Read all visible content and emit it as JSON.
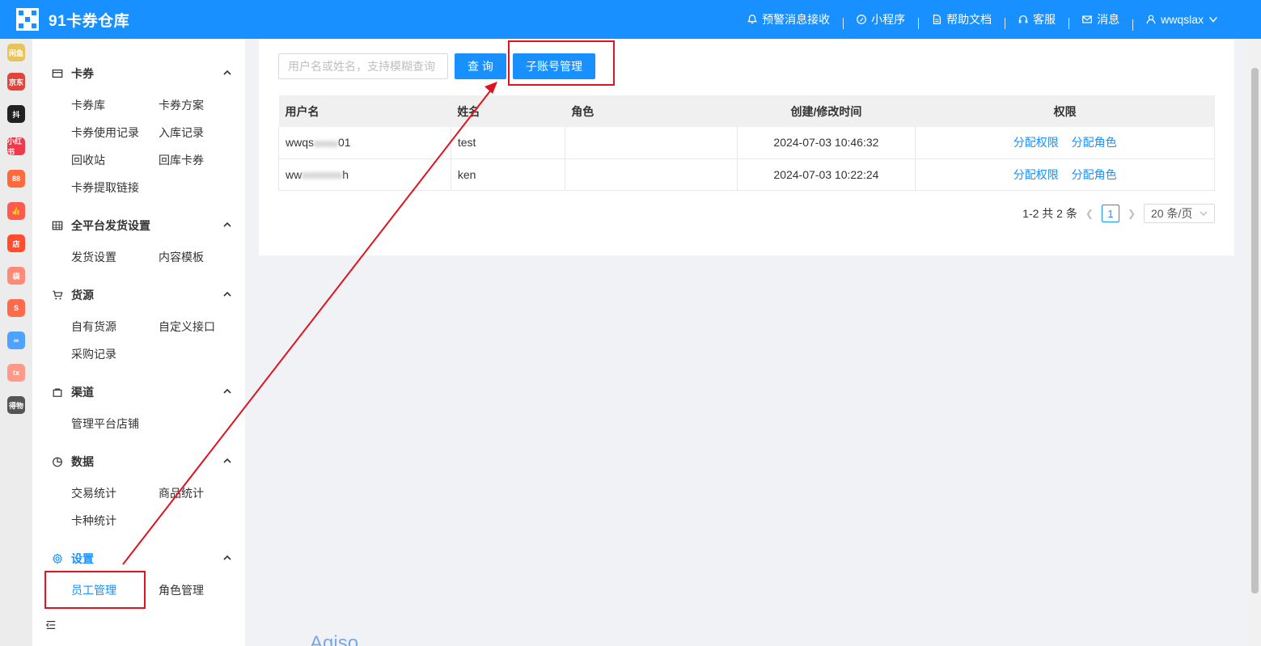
{
  "header": {
    "title": "91卡券仓库",
    "nav": [
      {
        "label": "预警消息接收",
        "icon": "alert-bell-icon"
      },
      {
        "label": "小程序",
        "icon": "mini-program-icon"
      },
      {
        "label": "帮助文档",
        "icon": "document-icon"
      },
      {
        "label": "客服",
        "icon": "headset-icon"
      },
      {
        "label": "消息",
        "icon": "mail-icon"
      },
      {
        "label": "wwqslax",
        "icon": "user-icon"
      }
    ]
  },
  "rail": {
    "apps": [
      {
        "label": "闲鱼",
        "color": "#e8c25a"
      },
      {
        "label": "京东",
        "color": "#e0473a"
      },
      {
        "label": "抖",
        "color": "#222222"
      },
      {
        "label": "小红书",
        "color": "#f03a4c"
      },
      {
        "label": "88",
        "color": "#ff6a3d"
      },
      {
        "label": "👍",
        "color": "#ff5a4e"
      },
      {
        "label": "店",
        "color": "#ff4d2e"
      },
      {
        "label": "袋",
        "color": "#ff8a7a"
      },
      {
        "label": "S",
        "color": "#ff6b4a"
      },
      {
        "label": "∞",
        "color": "#4da3ff"
      },
      {
        "label": "tx",
        "color": "#ff9a8a"
      },
      {
        "label": "得物",
        "color": "#555555"
      }
    ]
  },
  "sidebar": {
    "groups": [
      {
        "title": "卡券",
        "icon": "card-icon",
        "items": [
          "卡券库",
          "卡券方案",
          "卡券使用记录",
          "入库记录",
          "回收站",
          "回库卡券",
          "卡券提取链接"
        ]
      },
      {
        "title": "全平台发货设置",
        "icon": "grid-icon",
        "items": [
          "发货设置",
          "内容模板"
        ]
      },
      {
        "title": "货源",
        "icon": "cart-icon",
        "items": [
          "自有货源",
          "自定义接口",
          "采购记录"
        ]
      },
      {
        "title": "渠道",
        "icon": "bag-icon",
        "items": [
          "管理平台店铺"
        ]
      },
      {
        "title": "数据",
        "icon": "pie-chart-icon",
        "items": [
          "交易统计",
          "商品统计",
          "卡种统计"
        ]
      },
      {
        "title": "设置",
        "icon": "gear-icon",
        "items": [
          "员工管理",
          "角色管理"
        ]
      }
    ]
  },
  "main": {
    "search_placeholder": "用户名或姓名，支持模糊查询",
    "query_label": "查 询",
    "sub_account_label": "子账号管理",
    "columns": [
      "用户名",
      "姓名",
      "角色",
      "创建/修改时间",
      "权限"
    ],
    "rows": [
      {
        "username_prefix": "wwqs",
        "username_suffix": "01",
        "name": "test",
        "role": "",
        "time": "2024-07-03 10:46:32",
        "actions": [
          "分配权限",
          "分配角色"
        ]
      },
      {
        "username_prefix": "ww",
        "username_suffix": "h",
        "name": "ken",
        "role": "",
        "time": "2024-07-03 10:22:24",
        "actions": [
          "分配权限",
          "分配角色"
        ]
      }
    ],
    "pagination": {
      "summary": "1-2 共 2 条",
      "current_page": "1",
      "page_size": "20 条/页"
    }
  },
  "footer": {
    "logo_fragment": "Agiso"
  }
}
